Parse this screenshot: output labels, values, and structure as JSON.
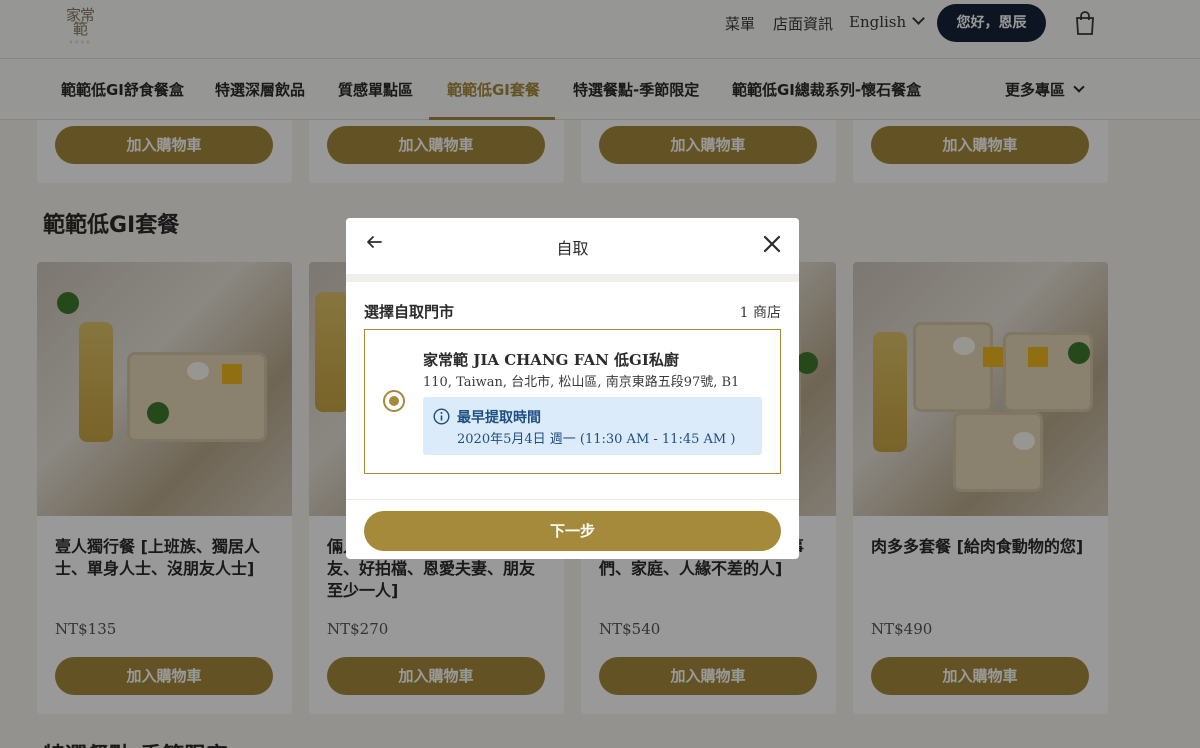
{
  "header": {
    "logo_text": "家常範",
    "links": [
      "菜單",
      "店面資訊"
    ],
    "language": "English",
    "greeting": "您好，恩辰"
  },
  "categories": {
    "items": [
      "範範低GI舒食餐盒",
      "特選深層飲品",
      "質感單點區",
      "範範低GI套餐",
      "特選餐點-季節限定",
      "範範低GI總裁系列-懷石餐盒"
    ],
    "active_index": 3,
    "more": "更多專區"
  },
  "top_cards": {
    "button_label": "加入購物車"
  },
  "section": {
    "title": "範範低GI套餐",
    "next_title": "特選餐點-季節限定"
  },
  "products": [
    {
      "name": "壹人獨行餐 [上班族、獨居人士、單身人士、沒朋友人士]",
      "price": "NT$135",
      "button": "加入購物車"
    },
    {
      "name": "倆人對對餐 [小倆口、好朋友、好拍檔、恩愛夫妻、朋友至少一人]",
      "price": "NT$270",
      "button": "加入購物車"
    },
    {
      "name": "四人團圓餐 [三五好友、同事們、家庭、人緣不差的人]",
      "price": "NT$540",
      "button": "加入購物車"
    },
    {
      "name": "肉多多套餐 [給肉食動物的您]",
      "price": "NT$490",
      "button": "加入購物車"
    }
  ],
  "modal": {
    "title": "自取",
    "store_label": "選擇自取門市",
    "store_count": "1 商店",
    "store": {
      "name": "家常範 JIA CHANG FAN 低GI私廚",
      "address": "110, Taiwan, 台北市, 松山區, 南京東路五段97號, B1",
      "pickup_title": "最早提取時間",
      "pickup_time": "2020年5月4日 週一 (11:30 AM - 11:45 AM )"
    },
    "next_button": "下一步"
  },
  "colors": {
    "accent": "#a58a3c",
    "dark_button": "#17233a",
    "info_bg": "#dcebf9",
    "info_text": "#1f4e82"
  }
}
